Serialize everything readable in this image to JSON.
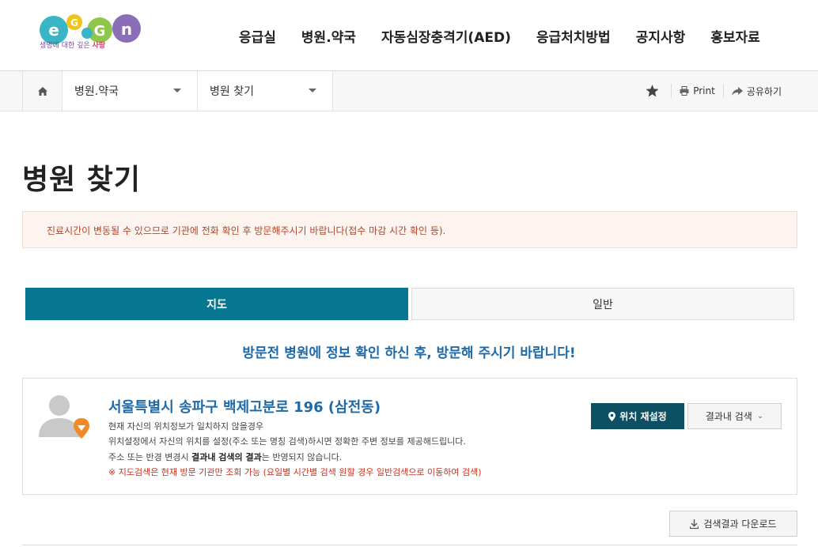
{
  "header": {
    "logo_tagline_a": "생명에 대한 깊은 ",
    "logo_tagline_b": "사랑",
    "nav": [
      "응급실",
      "병원.약국",
      "자동심장충격기(AED)",
      "응급처치방법",
      "공지사항",
      "홍보자료"
    ]
  },
  "breadcrumb": {
    "level1": "병원.약국",
    "level2": "병원 찾기",
    "print_label": "Print",
    "share_label": "공유하기"
  },
  "page": {
    "title": "병원 찾기",
    "notice": "진료시간이 변동될 수 있으므로 기관에 전화 확인 후 방문해주시기 바랍니다(접수 마감 시간 확인 등)."
  },
  "tabs": {
    "map": "지도",
    "general": "일반"
  },
  "guide_message": "방문전 병원에 정보 확인 하신 후, 방문해 주시기 바랍니다!",
  "location": {
    "address": "서울특별시 송파구 백제고분로 196 (삼전동)",
    "line1": "현재 자신의 위치정보가 일치하지 않을경우",
    "line2": "위치설정에서 자신의 위치를 설정(주소 또는 명칭 검색)하시면 정확한 주변 정보를 제공해드립니다.",
    "line3_a": "주소 또는 반경 변경시 ",
    "line3_b": "결과내 검색의 결과",
    "line3_c": "는 반영되지 않습니다.",
    "warning": "※ 지도검색은 현재 방문 기관만 조회 가능 (요일별 시간별 검색 원할 경우 일반검색으로 이동하여 검색)",
    "reset_button": "위치 재설정",
    "filter_button": "결과내 검색"
  },
  "download_button": "검색결과 다운로드",
  "colors": {
    "primary_teal": "#077690",
    "dark_teal": "#0d4f63",
    "link_blue": "#1e6aa8",
    "notice_text": "#b0472b",
    "notice_bg": "#fdf3ef",
    "marker_orange": "#f08a24"
  }
}
